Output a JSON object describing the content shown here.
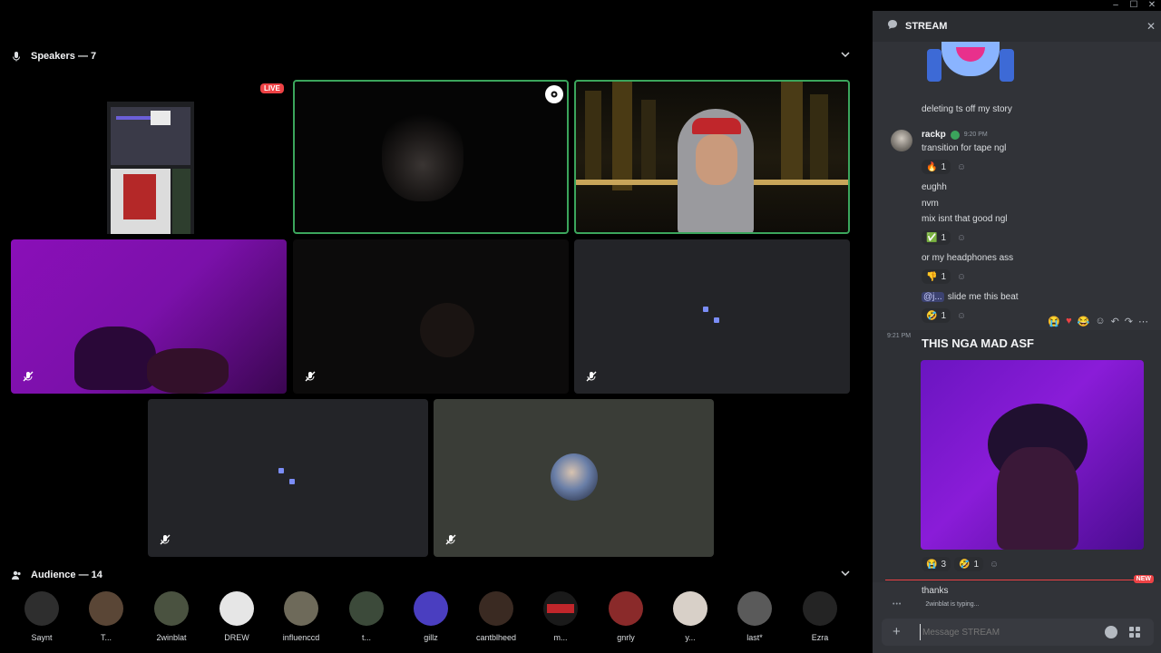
{
  "window": {
    "minimize": "–",
    "maximize": "☐",
    "close": "✕"
  },
  "speakers": {
    "heading": "Speakers — 7"
  },
  "tiles": {
    "live_badge": "LIVE"
  },
  "audience": {
    "heading": "Audience — 14",
    "members": [
      "Saynt",
      "T...",
      "2winblat",
      "DREW",
      "influenccd",
      "t...",
      "gillz",
      "cantblheed",
      "m...",
      "gnrly",
      "y...",
      "last*",
      "Ezra"
    ]
  },
  "chat": {
    "channel": "STREAM",
    "messages": {
      "m1": "deleting ts off my story",
      "author": "rackp",
      "author_time": "9:20 PM",
      "m2": "transition for tape ngl",
      "m3": "eughh",
      "m4": "nvm",
      "m5": "mix isnt that good ngl",
      "m6": "or my headphones ass",
      "mention": "@j...",
      "m7": "slide me this beat",
      "big_time": "9:21 PM",
      "big": "THIS NGA MAD ASF",
      "m8": "thanks"
    },
    "reactions": {
      "r1_count": "1",
      "r2_count": "1",
      "r3_count": "1",
      "r4_count": "1",
      "img_a_count": "3",
      "img_b_count": "1"
    },
    "new_badge": "NEW",
    "typing": "2winblat is typing...",
    "composer_placeholder": "Message STREAM"
  },
  "colors": {
    "speaking": "#3ba55c",
    "live": "#ed4245",
    "accent": "#7b8df7",
    "chat_bg": "#313338"
  }
}
